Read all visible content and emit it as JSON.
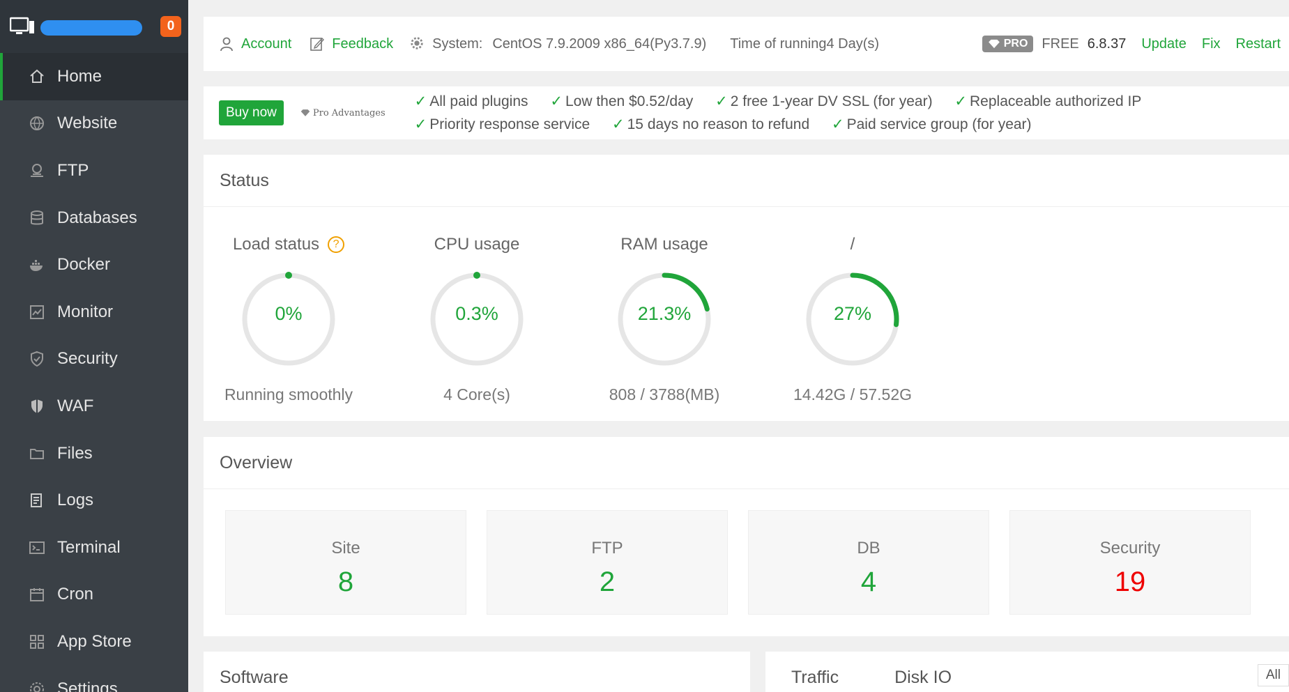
{
  "sidebar": {
    "badge": "0",
    "items": [
      {
        "label": "Home",
        "icon": "home-icon",
        "active": true
      },
      {
        "label": "Website",
        "icon": "globe-icon"
      },
      {
        "label": "FTP",
        "icon": "ftp-icon"
      },
      {
        "label": "Databases",
        "icon": "database-icon"
      },
      {
        "label": "Docker",
        "icon": "docker-icon"
      },
      {
        "label": "Monitor",
        "icon": "monitor-chart-icon"
      },
      {
        "label": "Security",
        "icon": "shield-icon"
      },
      {
        "label": "WAF",
        "icon": "waf-shield-icon"
      },
      {
        "label": "Files",
        "icon": "folder-icon"
      },
      {
        "label": "Logs",
        "icon": "log-file-icon"
      },
      {
        "label": "Terminal",
        "icon": "terminal-icon"
      },
      {
        "label": "Cron",
        "icon": "calendar-icon"
      },
      {
        "label": "App Store",
        "icon": "apps-grid-icon"
      },
      {
        "label": "Settings",
        "icon": "gear-icon"
      }
    ]
  },
  "topbar": {
    "account": "Account",
    "feedback": "Feedback",
    "system_label": "System:",
    "system_value": "CentOS 7.9.2009 x86_64(Py3.7.9)",
    "running": "Time of running4 Day(s)",
    "pro": "PRO",
    "edition": "FREE",
    "version": "6.8.37",
    "update": "Update",
    "fix": "Fix",
    "restart": "Restart"
  },
  "probar": {
    "buy": "Buy now",
    "advantages": "Pro Advantages",
    "row1": [
      "All paid plugins",
      "Low then $0.52/day",
      "2 free 1-year DV SSL (for year)",
      "Replaceable authorized IP"
    ],
    "row2": [
      "Priority response service",
      "15 days no reason to refund",
      "Paid service group (for year)"
    ]
  },
  "status": {
    "title": "Status",
    "gauges": [
      {
        "label": "Load status",
        "value": "0%",
        "pct": 0,
        "sub": "Running smoothly",
        "help": "?"
      },
      {
        "label": "CPU usage",
        "value": "0.3%",
        "pct": 0.3,
        "sub": "4 Core(s)"
      },
      {
        "label": "RAM usage",
        "value": "21.3%",
        "pct": 21.3,
        "sub": "808 / 3788(MB)"
      },
      {
        "label": "/",
        "value": "27%",
        "pct": 27,
        "sub": "14.42G / 57.52G"
      }
    ]
  },
  "overview": {
    "title": "Overview",
    "cards": [
      {
        "label": "Site",
        "value": "8"
      },
      {
        "label": "FTP",
        "value": "2"
      },
      {
        "label": "DB",
        "value": "4"
      },
      {
        "label": "Security",
        "value": "19"
      }
    ]
  },
  "software": {
    "title": "Software"
  },
  "traffic": {
    "tab1": "Traffic",
    "tab2": "Disk IO",
    "all": "All"
  },
  "colors": {
    "accent": "#20a53a",
    "sidebar": "#3a4046",
    "danger": "#e00000",
    "badge": "#f3631c"
  }
}
